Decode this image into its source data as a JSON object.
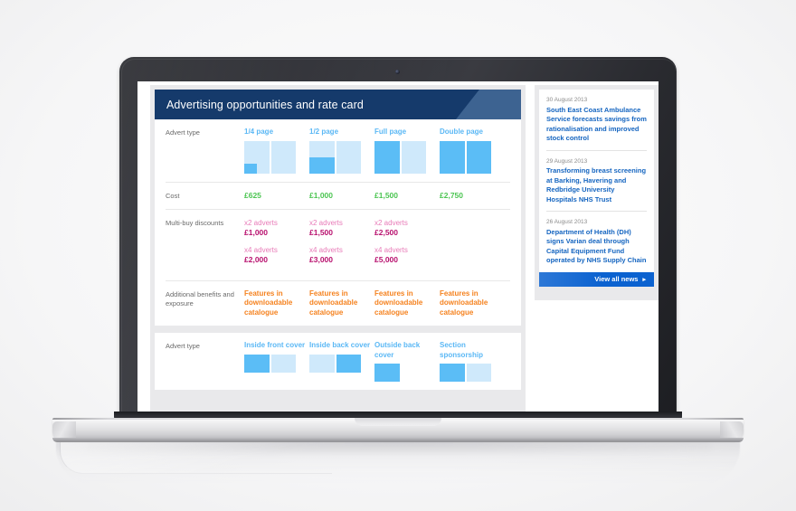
{
  "header": {
    "title": "Advertising opportunities and rate card"
  },
  "rate_card": {
    "rows": {
      "advert_type_label": "Advert type",
      "cost_label": "Cost",
      "multibuy_label": "Multi-buy discounts",
      "benefits_label": "Additional benefits and exposure"
    },
    "columns": [
      {
        "name": "1/4 page",
        "diagram": "quarter",
        "cost": "£625",
        "multibuy": [
          {
            "qty": "x2 adverts",
            "price": "£1,000"
          },
          {
            "qty": "x4 adverts",
            "price": "£2,000"
          }
        ],
        "benefit": "Features in downloadable catalogue"
      },
      {
        "name": "1/2 page",
        "diagram": "half",
        "cost": "£1,000",
        "multibuy": [
          {
            "qty": "x2 adverts",
            "price": "£1,500"
          },
          {
            "qty": "x4 adverts",
            "price": "£3,000"
          }
        ],
        "benefit": "Features in downloadable catalogue"
      },
      {
        "name": "Full page",
        "diagram": "full",
        "cost": "£1,500",
        "multibuy": [
          {
            "qty": "x2 adverts",
            "price": "£2,500"
          },
          {
            "qty": "x4 adverts",
            "price": "£5,000"
          }
        ],
        "benefit": "Features in downloadable catalogue"
      },
      {
        "name": "Double page",
        "diagram": "double",
        "cost": "£2,750",
        "multibuy": [],
        "benefit": "Features in downloadable catalogue"
      }
    ]
  },
  "rate_card_two": {
    "advert_type_label": "Advert type",
    "columns": [
      {
        "name": "Inside front cover",
        "diagram": "inside-front"
      },
      {
        "name": "Inside back cover",
        "diagram": "inside-back"
      },
      {
        "name": "Outside back cover",
        "diagram": "outside-back"
      },
      {
        "name": "Section sponsorship",
        "diagram": "section"
      }
    ]
  },
  "news": {
    "items": [
      {
        "date": "30 August 2013",
        "title": "South East Coast Ambulance Service forecasts savings from rationalisation and improved stock control"
      },
      {
        "date": "29 August 2013",
        "title": "Transforming breast screening at Barking, Havering and Redbridge University Hospitals NHS Trust"
      },
      {
        "date": "26 August 2013",
        "title": "Department of Health (DH) signs Varian deal through Capital Equipment Fund operated by NHS Supply Chain"
      }
    ],
    "button_label": "View all news",
    "button_arrow": "▸"
  },
  "colors": {
    "header_band": "#153a6b",
    "header_wedge": "#3d6391",
    "column_heading": "#5bb8f5",
    "cost": "#4cc552",
    "multibuy_qty": "#e87bb8",
    "multibuy_price": "#b8106e",
    "benefit": "#f5821f",
    "news_link": "#1565c0",
    "news_button": "#0b62d0",
    "diagram_light": "#cfe9fb",
    "diagram_dark": "#5bbdf6"
  }
}
